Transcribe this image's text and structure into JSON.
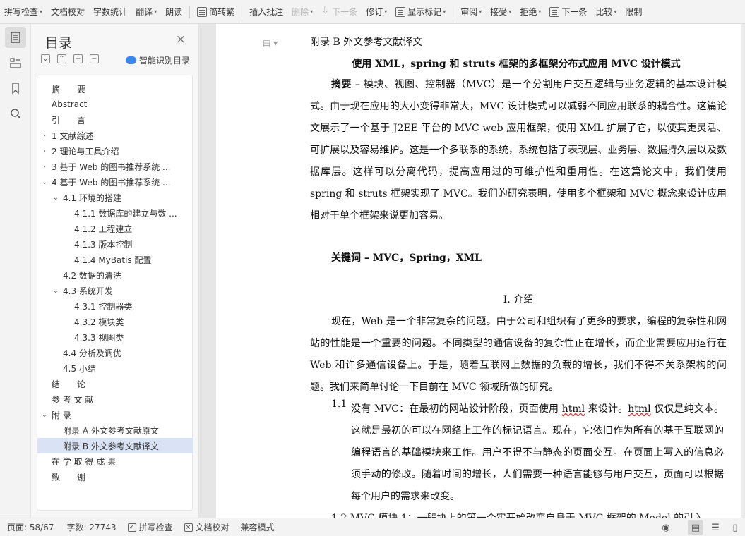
{
  "toolbar": {
    "items": [
      {
        "label": "拼写检查",
        "dropdown": true
      },
      {
        "label": "文档校对",
        "dropdown": false
      },
      {
        "label": "字数统计",
        "dropdown": false
      },
      {
        "label": "翻译",
        "dropdown": true
      },
      {
        "label": "朗读",
        "dropdown": false
      },
      {
        "label": "简转繁",
        "dropdown": false
      },
      {
        "label": "插入批注",
        "dropdown": false
      },
      {
        "label": "删除",
        "dropdown": true,
        "disabled": true
      },
      {
        "label": "下一条",
        "dropdown": false,
        "disabled": true
      },
      {
        "label": "修订",
        "dropdown": true
      },
      {
        "label": "显示标记",
        "dropdown": true
      },
      {
        "label": "审阅",
        "dropdown": true
      },
      {
        "label": "接受",
        "dropdown": true
      },
      {
        "label": "拒绝",
        "dropdown": true
      },
      {
        "label": "下一条",
        "dropdown": false
      },
      {
        "label": "比较",
        "dropdown": true
      },
      {
        "label": "限制",
        "dropdown": false
      }
    ]
  },
  "toc": {
    "title": "目录",
    "close": "×",
    "smart_label": "智能识别目录",
    "items": [
      {
        "label": "摘　　要",
        "indent": 0,
        "chevron": ""
      },
      {
        "label": "Abstract",
        "indent": 0,
        "chevron": ""
      },
      {
        "label": "引　　言",
        "indent": 0,
        "chevron": ""
      },
      {
        "label": "1 文献综述",
        "indent": 0,
        "chevron": "›"
      },
      {
        "label": "2 理论与工具介绍",
        "indent": 0,
        "chevron": "›"
      },
      {
        "label": "3  基于 Web 的图书推荐系统 ...",
        "indent": 0,
        "chevron": "›"
      },
      {
        "label": "4  基于 Web 的图书推荐系统 ...",
        "indent": 0,
        "chevron": "⌄"
      },
      {
        "label": "4.1  环境的搭建",
        "indent": 1,
        "chevron": "⌄"
      },
      {
        "label": "4.1.1  数据库的建立与数 ...",
        "indent": 2,
        "chevron": ""
      },
      {
        "label": "4.1.2  工程建立",
        "indent": 2,
        "chevron": ""
      },
      {
        "label": "4.1.3  版本控制",
        "indent": 2,
        "chevron": ""
      },
      {
        "label": "4.1.4 MyBatis 配置",
        "indent": 2,
        "chevron": ""
      },
      {
        "label": "4.2  数据的清洗",
        "indent": 1,
        "chevron": ""
      },
      {
        "label": "4.3  系统开发",
        "indent": 1,
        "chevron": "⌄"
      },
      {
        "label": "4.3.1  控制器类",
        "indent": 2,
        "chevron": ""
      },
      {
        "label": "4.3.2  模块类",
        "indent": 2,
        "chevron": ""
      },
      {
        "label": "4.3.3  视图类",
        "indent": 2,
        "chevron": ""
      },
      {
        "label": "4.4  分析及调优",
        "indent": 1,
        "chevron": ""
      },
      {
        "label": "4.5  小结",
        "indent": 1,
        "chevron": ""
      },
      {
        "label": "结　　论",
        "indent": 0,
        "chevron": ""
      },
      {
        "label": "参 考 文 献",
        "indent": 0,
        "chevron": ""
      },
      {
        "label": "附  录",
        "indent": 0,
        "chevron": "⌄"
      },
      {
        "label": "附录 A  外文参考文献原文",
        "indent": 1,
        "chevron": ""
      },
      {
        "label": "附录 B  外文参考文献译文",
        "indent": 1,
        "chevron": "",
        "selected": true
      },
      {
        "label": "在 学 取 得 成 果",
        "indent": 0,
        "chevron": ""
      },
      {
        "label": "致　　谢",
        "indent": 0,
        "chevron": ""
      }
    ]
  },
  "document": {
    "heading": "附录 B  外文参考文献译文",
    "title": "使用 XML，spring 和 struts 框架的多框架分布式应用 MVC 设计模式",
    "abstract_lead": "摘要",
    "abstract_text": " – 模块、视图、控制器（MVC）是一个分割用户交互逻辑与业务逻辑的基本设计模式。由于现在应用的大小变得非常大，MVC 设计模式可以减弱不同应用联系的耦合性。这篇论文展示了一个基于 J2EE 平台的 MVC web 应用框架，使用 XML 扩展了它，以使其更灵活、可扩展以及容易维护。这是一个多联系的系统，系统包括了表现层、业务层、数据持久层以及数据库层。这样可以分离代码，提高应用过的可维护性和重用性。在这篇论文中，我们使用 spring 和 struts 框架实现了 MVC。我们的研究表明，使用多个框架和 MVC 概念来设计应用相对于单个框架来说更加容易。",
    "keywords": "关键词 – MVC，Spring，XML",
    "section_title": "I.   介绍",
    "intro_text": "现在，Web 是一个非常复杂的问题。由于公司和组织有了更多的要求，编程的复杂性和网站的性能是一个重要的问题。不同类型的通信设备的复杂性正在增长，而企业需要应用运行在 Web 和许多通信设备上。于是，随着互联网上数据的负载的增长，我们不得不关系架构的问题。我们来简单讨论一下目前在 MVC 领域所做的研究。",
    "item_num": "1.1",
    "item_text_a": "没有 MVC：在最初的网站设计阶段，页面使用 ",
    "item_word_1": "html",
    "item_text_b": " 来设计。",
    "item_word_2": "html",
    "item_text_c": " 仅仅是纯文本。这就是最初的可以在网络上工作的标记语言。现在，它依旧作为所有的基于互联网的编程语言的基础模块来工作。用户不得不与静态的页面交互。在页面上写入的信息必须手动的修改。随着时间的增长，人们需要一种语言能够与用户交互，页面可以根据每个用户的需求来改变。",
    "cut_text": "1.2  MVC 模块 1：一般协上的第一个实开始改变自身于 MVC 框架的 Model 的引入"
  },
  "status": {
    "page": "页面: 58/67",
    "words": "字数: 27743",
    "spell": "拼写检查",
    "proof": "文档校对",
    "compat": "兼容模式"
  }
}
